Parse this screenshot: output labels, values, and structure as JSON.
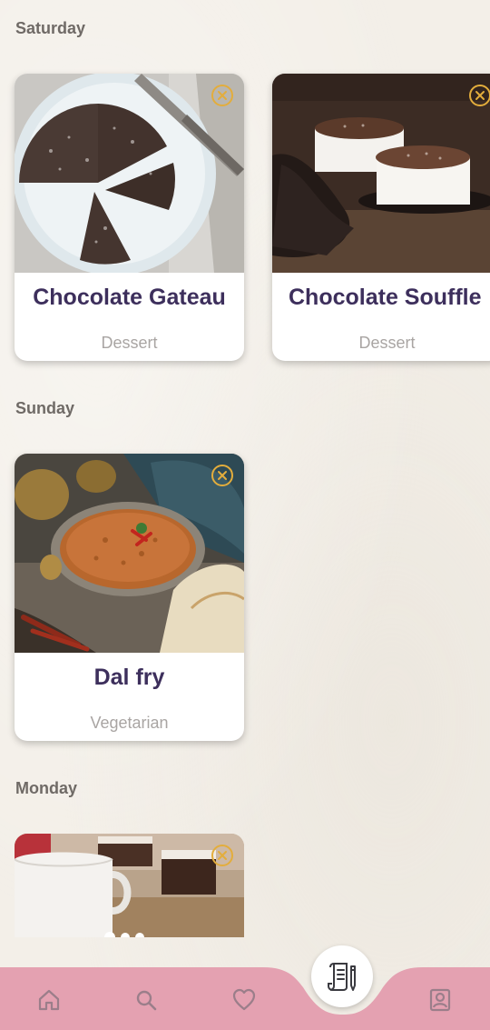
{
  "colors": {
    "background": "#f3efe8",
    "title": "#3d2f5c",
    "category": "#a9a5a3",
    "remove_icon": "#e3ad3c",
    "nav_bar": "#e4a1b1",
    "nav_icon": "#9b7e8a"
  },
  "days": [
    {
      "label": "Saturday",
      "recipes": [
        {
          "title": "Chocolate Gateau",
          "category": "Dessert",
          "image": "chocolate-gateau-photo",
          "action_icon": "remove-circle-icon"
        },
        {
          "title": "Chocolate Souffle",
          "category": "Dessert",
          "image": "chocolate-souffle-photo",
          "action_icon": "remove-circle-icon"
        }
      ]
    },
    {
      "label": "Sunday",
      "recipes": [
        {
          "title": "Dal fry",
          "category": "Vegetarian",
          "image": "dal-fry-photo",
          "action_icon": "remove-circle-icon"
        }
      ]
    },
    {
      "label": "Monday",
      "recipes": [
        {
          "image": "brownie-and-mug-photo",
          "action_icon": "remove-circle-icon"
        }
      ]
    }
  ],
  "bottom_nav": {
    "items": [
      {
        "icon": "home-icon"
      },
      {
        "icon": "search-icon"
      },
      {
        "icon": "heart-icon"
      },
      {
        "icon": "meal-plan-notes-icon",
        "active": true
      },
      {
        "icon": "profile-icon"
      }
    ]
  }
}
